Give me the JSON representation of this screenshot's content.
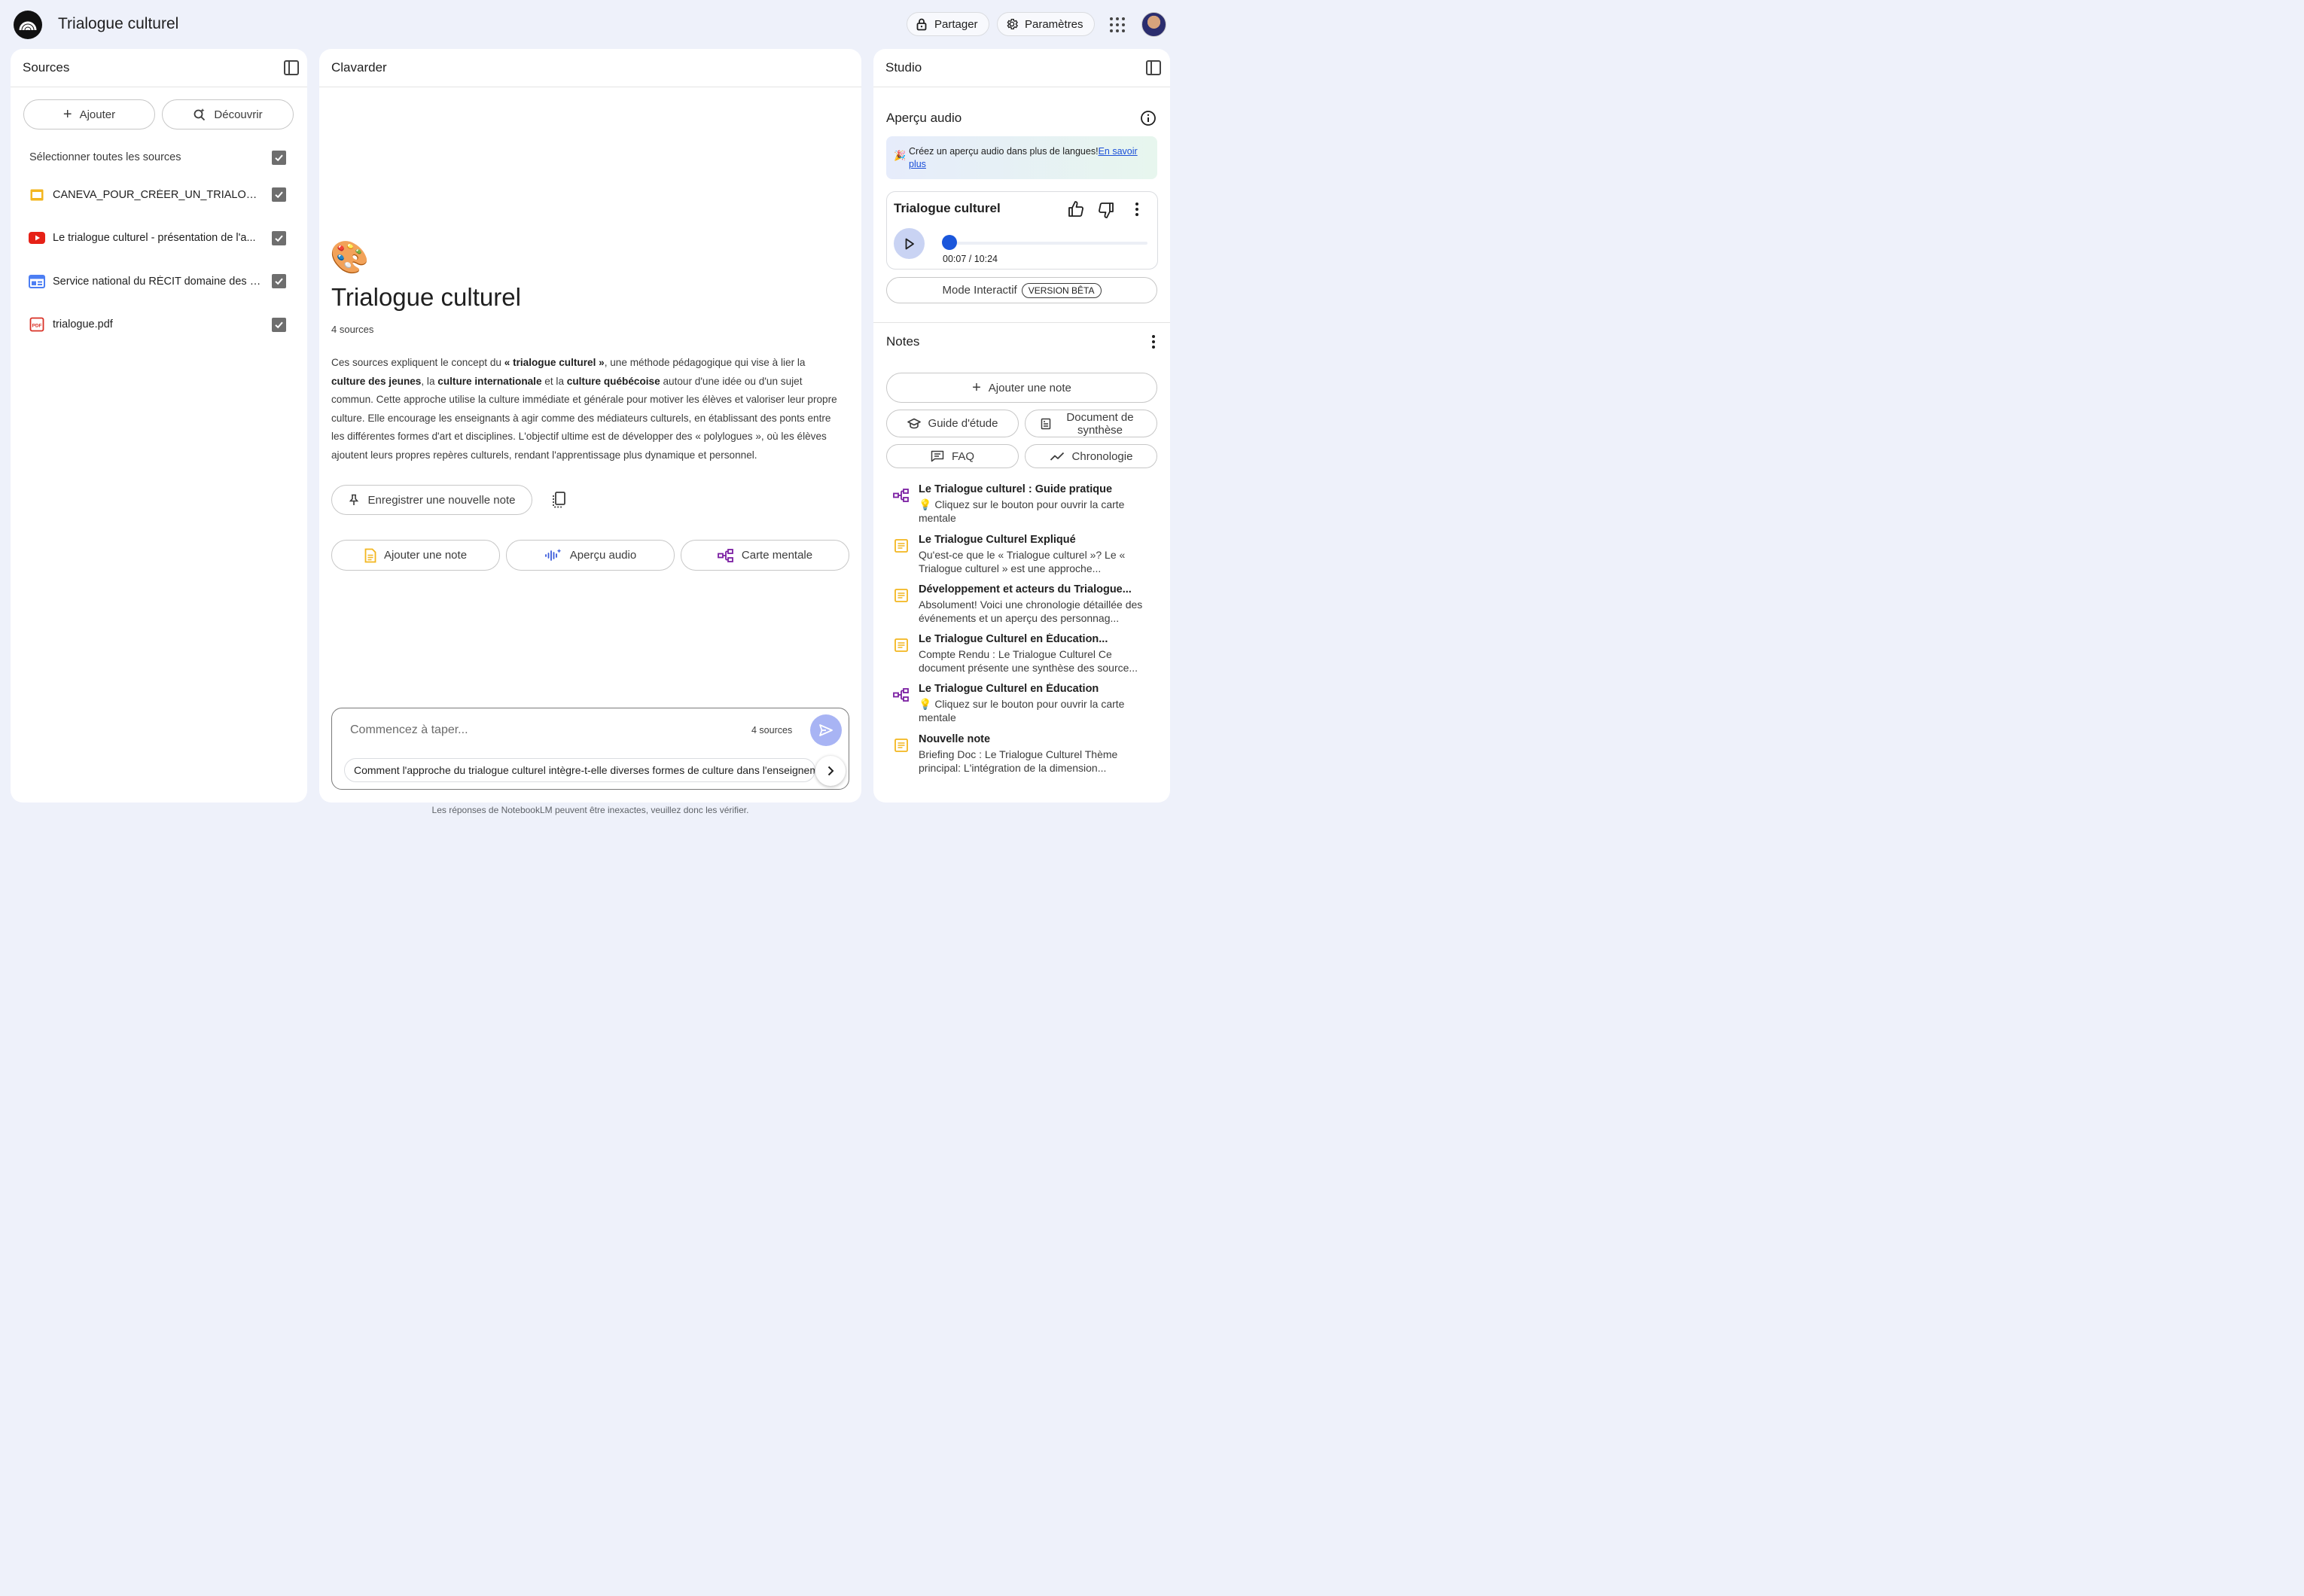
{
  "app": {
    "title": "Trialogue culturel",
    "share_label": "Partager",
    "settings_label": "Paramètres"
  },
  "sources_panel": {
    "title": "Sources",
    "add_label": "Ajouter",
    "discover_label": "Découvrir",
    "select_all_label": "Sélectionner toutes les sources",
    "items": [
      {
        "label": "CANEVA_POUR_CRÉER_UN_TRIALOGUE",
        "type": "slides-icon",
        "checked": true
      },
      {
        "label": "Le trialogue culturel - présentation de l'a...",
        "type": "youtube-icon",
        "checked": true
      },
      {
        "label": "Service national du RÉCIT domaine des a...",
        "type": "web-icon",
        "checked": true
      },
      {
        "label": "trialogue.pdf",
        "type": "pdf-icon",
        "checked": true
      }
    ]
  },
  "chat_panel": {
    "title": "Clavarder",
    "emoji": "🎨",
    "notebook_title": "Trialogue culturel",
    "source_count": "4 sources",
    "summary": {
      "p1": "Ces sources expliquent le concept du ",
      "b1": "« trialogue culturel »",
      "p2": ", une méthode pédagogique qui vise à lier la ",
      "b2": "culture des jeunes",
      "p3": ", la ",
      "b3": "culture internationale",
      "p4": " et la ",
      "b4": "culture québécoise",
      "p5": " autour d'une idée ou d'un sujet commun. Cette approche utilise la culture immédiate et générale pour motiver les élèves et valoriser leur propre culture. Elle encourage les enseignants à agir comme des médiateurs culturels, en établissant des ponts entre les différentes formes d'art et disciplines. L'objectif ultime est de développer des « polylogues », où les élèves ajoutent leurs propres repères culturels, rendant l'apprentissage plus dynamique et personnel."
    },
    "save_note_label": "Enregistrer une nouvelle note",
    "actions": {
      "add_note": "Ajouter une note",
      "audio_overview": "Aperçu audio",
      "mind_map": "Carte mentale"
    },
    "input_placeholder": "Commencez à taper...",
    "input_source_count": "4 sources",
    "suggestion": "Comment l'approche du trialogue culturel intègre-t-elle diverses formes de culture dans l'enseignement ?",
    "footer_note": "Les réponses de NotebookLM peuvent être inexactes, veuillez donc les vérifier."
  },
  "studio_panel": {
    "title": "Studio",
    "audio_section_title": "Aperçu audio",
    "promo": {
      "emoji": "🎉",
      "text": "Créez un aperçu audio dans plus de langues!",
      "link": "En savoir plus"
    },
    "audio_card": {
      "title": "Trialogue culturel",
      "time": "00:07 / 10:24",
      "progress": 0.011
    },
    "interactive_mode_label": "Mode Interactif",
    "beta_badge": "VERSION BÊTA",
    "notes_title": "Notes",
    "add_note_label": "Ajouter une note",
    "tools": {
      "study_guide": "Guide d'étude",
      "briefing_doc": "Document de synthèse",
      "faq": "FAQ",
      "timeline": "Chronologie"
    },
    "notes": [
      {
        "title": "Le Trialogue culturel : Guide pratique",
        "preview": "💡 Cliquez sur le bouton pour ouvrir la carte mentale",
        "icon": "mind-map-icon"
      },
      {
        "title": "Le Trialogue Culturel Expliqué",
        "preview": "Qu'est-ce que le « Trialogue culturel »? Le « Trialogue culturel » est une approche...",
        "icon": "note-icon"
      },
      {
        "title": "Développement et acteurs du Trialogue...",
        "preview": "Absolument! Voici une chronologie détaillée des événements et un aperçu des personnag...",
        "icon": "note-icon"
      },
      {
        "title": "Le Trialogue Culturel en Éducation...",
        "preview": "Compte Rendu : Le Trialogue Culturel Ce document présente une synthèse des source...",
        "icon": "note-icon"
      },
      {
        "title": "Le Trialogue Culturel en Éducation",
        "preview": "💡 Cliquez sur le bouton pour ouvrir la carte mentale",
        "icon": "mind-map-icon"
      },
      {
        "title": "Nouvelle note",
        "preview": "Briefing Doc : Le Trialogue Culturel Thème principal: L'intégration de la dimension...",
        "icon": "note-icon"
      }
    ]
  },
  "colors": {
    "background": "#eef1fa",
    "accent_blue": "#1a56db",
    "send_button": "#a8b4f4",
    "note_yellow": "#f3b61f",
    "mind_map_purple": "#7b1fa2",
    "youtube_red": "#e62117",
    "pdf_red": "#d93025"
  }
}
